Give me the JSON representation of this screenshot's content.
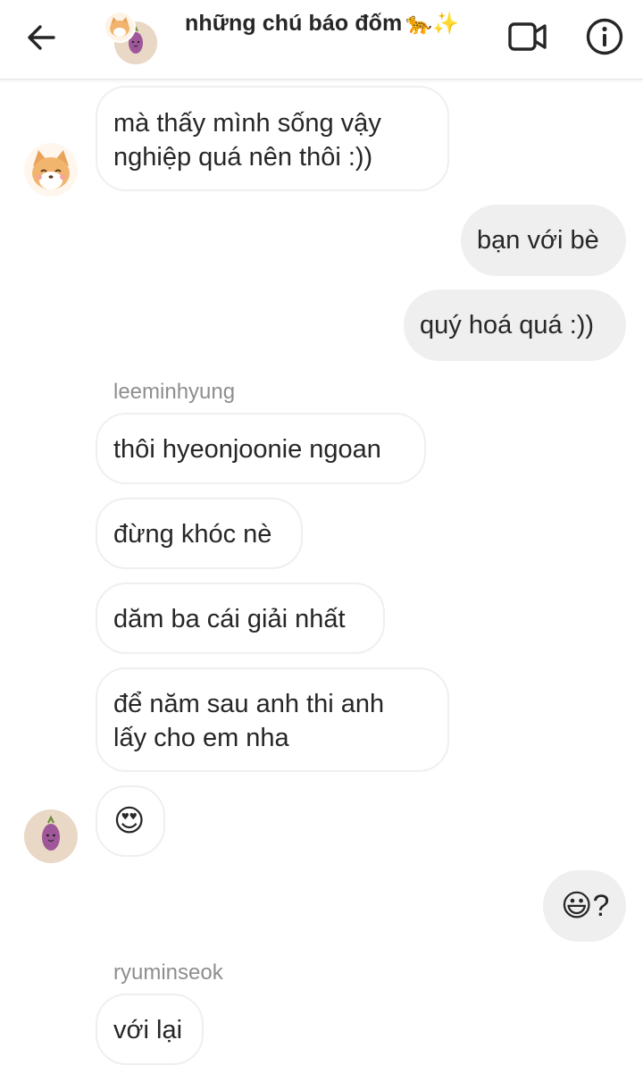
{
  "header": {
    "title": "những chú báo đốm",
    "title_emoji": "🐆✨",
    "back_icon": "arrow-left-icon",
    "video_icon": "video-camera-icon",
    "info_icon": "info-circle-icon"
  },
  "messages": [
    {
      "text_line1": "mà thấy mình sống vậy",
      "text_line2": "nghiệp quá nên thôi :))"
    },
    {
      "text": "bạn với bè"
    },
    {
      "text": "quý hoá quá :))"
    },
    {
      "sender": "leeminhyung"
    },
    {
      "text": "thôi hyeonjoonie ngoan"
    },
    {
      "text": "đừng khóc nè"
    },
    {
      "text": "dăm ba cái giải nhất"
    },
    {
      "text_line1": "để năm sau anh thi anh",
      "text_line2": "lấy cho em nha"
    },
    {
      "text": "😍"
    },
    {
      "text": "😃?"
    },
    {
      "sender": "ryuminseok"
    },
    {
      "text": "với lại"
    }
  ],
  "colors": {
    "incoming_border": "#efefef",
    "outgoing_bg": "#efefef",
    "text": "#262626",
    "sender": "#8e8e8e"
  }
}
